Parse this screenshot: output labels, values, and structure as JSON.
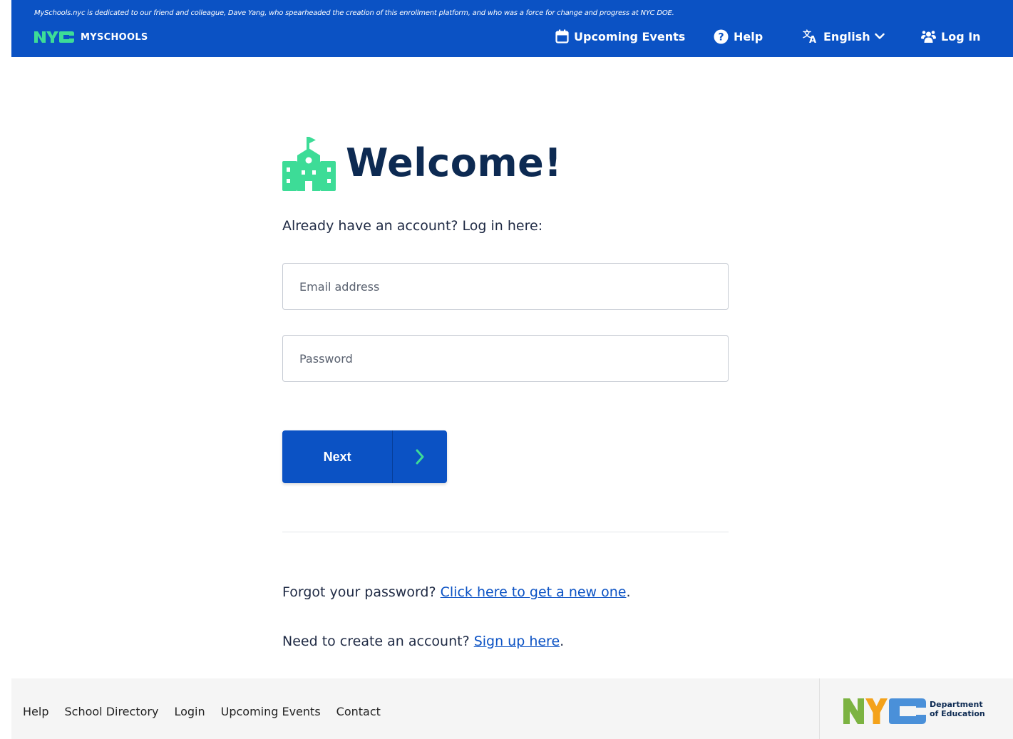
{
  "header": {
    "dedication": "MySchools.nyc is dedicated to our friend and colleague, Dave Yang, who spearheaded the creation of this enrollment platform, and who was a force for change and progress at NYC DOE.",
    "brand_logo": "NYC",
    "brand_name": "MYSCHOOLS",
    "nav": {
      "events": "Upcoming Events",
      "help": "Help",
      "language": "English",
      "login": "Log In"
    }
  },
  "main": {
    "title": "Welcome!",
    "intro": "Already have an account? Log in here:",
    "email_placeholder": "Email address",
    "password_placeholder": "Password",
    "next_label": "Next",
    "forgot_text": "Forgot your password? ",
    "forgot_link": "Click here to get a new one",
    "forgot_end": ".",
    "signup_text": "Need to create an account? ",
    "signup_link": "Sign up here",
    "signup_end": "."
  },
  "footer": {
    "links": [
      "Help",
      "School Directory",
      "Login",
      "Upcoming Events",
      "Contact"
    ],
    "doe_logo": "NYC",
    "doe_text": "Department of Education"
  },
  "colors": {
    "primary": "#0b52c4",
    "brand_green": "#3ddc97",
    "title_navy": "#0d2a52"
  }
}
